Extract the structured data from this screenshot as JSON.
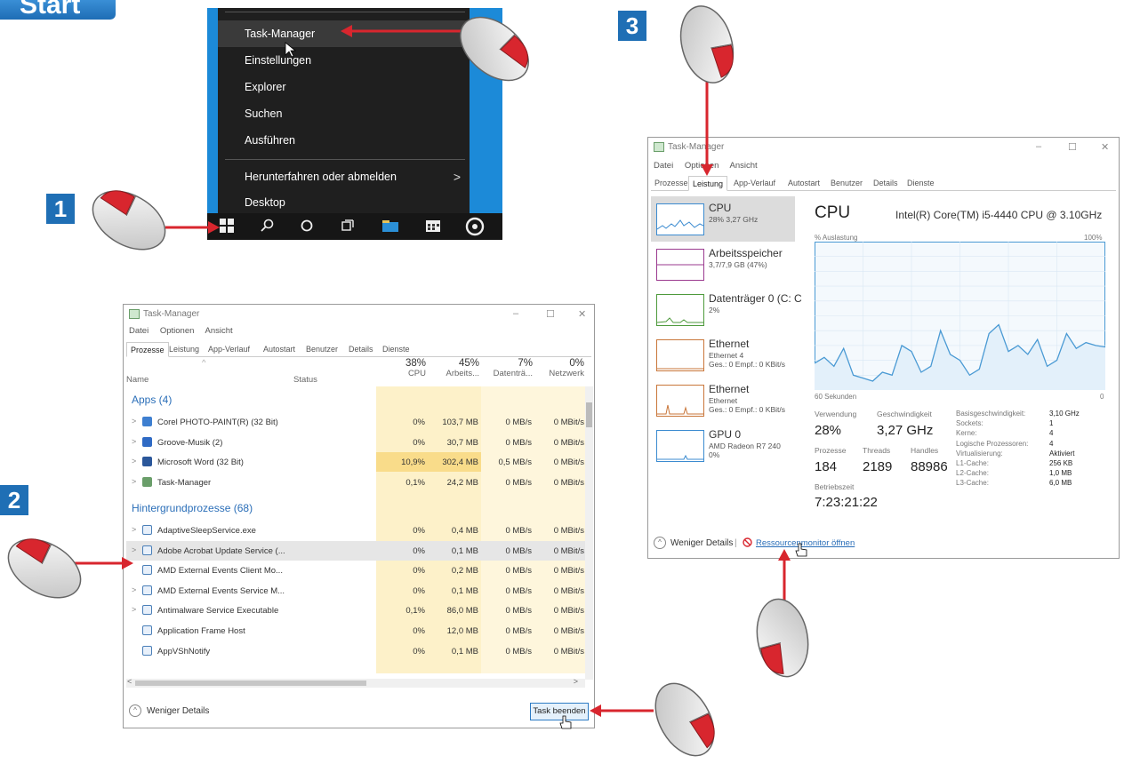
{
  "badges": {
    "start": "Start",
    "step1": "1",
    "step2": "2",
    "step3": "3"
  },
  "start_menu": {
    "items": [
      "Task-Manager",
      "Einstellungen",
      "Explorer",
      "Suchen",
      "Ausführen",
      "Herunterfahren oder abmelden",
      "Desktop"
    ],
    "chevron": ">"
  },
  "task_manager": {
    "title": "Task-Manager",
    "menu": [
      "Datei",
      "Optionen",
      "Ansicht"
    ],
    "tabs": [
      "Prozesse",
      "Leistung",
      "App-Verlauf",
      "Autostart",
      "Benutzer",
      "Details",
      "Dienste"
    ],
    "window_controls": [
      "–",
      "☐",
      "✕"
    ]
  },
  "processes": {
    "header": {
      "name": "Name",
      "status": "Status",
      "cpu_pct": "38%",
      "cpu_label": "CPU",
      "mem_pct": "45%",
      "mem_label": "Arbeits...",
      "disk_pct": "7%",
      "disk_label": "Datenträ...",
      "net_pct": "0%",
      "net_label": "Netzwerk"
    },
    "group_apps": "Apps (4)",
    "group_bg": "Hintergrundprozesse (68)",
    "apps": [
      {
        "name": "Corel PHOTO-PAINT(R) (32 Bit)",
        "cpu": "0%",
        "mem": "103,7 MB",
        "disk": "0 MB/s",
        "net": "0 MBit/s",
        "color": "#3e7fd0"
      },
      {
        "name": "Groove-Musik (2)",
        "cpu": "0%",
        "mem": "30,7 MB",
        "disk": "0 MB/s",
        "net": "0 MBit/s",
        "color": "#2f6ac4"
      },
      {
        "name": "Microsoft Word (32 Bit)",
        "cpu": "10,9%",
        "mem": "302,4 MB",
        "disk": "0,5 MB/s",
        "net": "0 MBit/s",
        "color": "#2b579a"
      },
      {
        "name": "Task-Manager",
        "cpu": "0,1%",
        "mem": "24,2 MB",
        "disk": "0 MB/s",
        "net": "0 MBit/s",
        "color": "#6a9e6a"
      }
    ],
    "background": [
      {
        "name": "AdaptiveSleepService.exe",
        "cpu": "0%",
        "mem": "0,4 MB",
        "disk": "0 MB/s",
        "net": "0 MBit/s"
      },
      {
        "name": "Adobe Acrobat Update Service (...",
        "cpu": "0%",
        "mem": "0,1 MB",
        "disk": "0 MB/s",
        "net": "0 MBit/s"
      },
      {
        "name": "AMD External Events Client Mo...",
        "cpu": "0%",
        "mem": "0,2 MB",
        "disk": "0 MB/s",
        "net": "0 MBit/s"
      },
      {
        "name": "AMD External Events Service M...",
        "cpu": "0%",
        "mem": "0,1 MB",
        "disk": "0 MB/s",
        "net": "0 MBit/s"
      },
      {
        "name": "Antimalware Service Executable",
        "cpu": "0,1%",
        "mem": "86,0 MB",
        "disk": "0 MB/s",
        "net": "0 MBit/s"
      },
      {
        "name": "Application Frame Host",
        "cpu": "0%",
        "mem": "12,0 MB",
        "disk": "0 MB/s",
        "net": "0 MBit/s"
      },
      {
        "name": "AppVShNotify",
        "cpu": "0%",
        "mem": "0,1 MB",
        "disk": "0 MB/s",
        "net": "0 MBit/s"
      }
    ],
    "footer_less": "Weniger Details",
    "end_task": "Task beenden",
    "scroll_left": "<",
    "scroll_right": ">"
  },
  "performance": {
    "sidebar": [
      {
        "name": "CPU",
        "sub1": "28% 3,27 GHz",
        "sub2": "",
        "color": "#3b8bd0"
      },
      {
        "name": "Arbeitsspeicher",
        "sub1": "3,7/7,9 GB (47%)",
        "sub2": "",
        "color": "#9b3a8f"
      },
      {
        "name": "Datenträger 0 (C: C",
        "sub1": "2%",
        "sub2": "",
        "color": "#4e9a3c"
      },
      {
        "name": "Ethernet",
        "sub1": "Ethernet 4",
        "sub2": "Ges.: 0 Empf.: 0 KBit/s",
        "color": "#c9763a"
      },
      {
        "name": "Ethernet",
        "sub1": "Ethernet",
        "sub2": "Ges.: 0 Empf.: 0 KBit/s",
        "color": "#c9763a"
      },
      {
        "name": "GPU 0",
        "sub1": "AMD Radeon R7 240",
        "sub2": "0%",
        "color": "#3b8bd0"
      }
    ],
    "title": "CPU",
    "cpu_name": "Intel(R) Core(TM) i5-4440 CPU @ 3.10GHz",
    "graph_top_left": "% Auslastung",
    "graph_top_right": "100%",
    "graph_bottom_left": "60 Sekunden",
    "graph_bottom_right": "0",
    "usage_series": [
      18,
      22,
      16,
      28,
      10,
      8,
      6,
      12,
      10,
      30,
      26,
      12,
      16,
      40,
      24,
      20,
      10,
      14,
      38,
      44,
      26,
      30,
      24,
      34,
      16,
      20,
      38,
      28,
      32,
      30,
      29
    ],
    "stats": {
      "usage_label": "Verwendung",
      "usage_value": "28%",
      "speed_label": "Geschwindigkeit",
      "speed_value": "3,27 GHz",
      "proc_label": "Prozesse",
      "proc_value": "184",
      "threads_label": "Threads",
      "threads_value": "2189",
      "handles_label": "Handles",
      "handles_value": "88986",
      "uptime_label": "Betriebszeit",
      "uptime_value": "7:23:21:22"
    },
    "specs": [
      {
        "label": "Basisgeschwindigkeit:",
        "value": "3,10 GHz"
      },
      {
        "label": "Sockets:",
        "value": "1"
      },
      {
        "label": "Kerne:",
        "value": "4"
      },
      {
        "label": "Logische Prozessoren:",
        "value": "4"
      },
      {
        "label": "Virtualisierung:",
        "value": "Aktiviert"
      },
      {
        "label": "L1-Cache:",
        "value": "256 KB"
      },
      {
        "label": "L2-Cache:",
        "value": "1,0 MB"
      },
      {
        "label": "L3-Cache:",
        "value": "6,0 MB"
      }
    ],
    "footer_less": "Weniger Details",
    "footer_sep": "|",
    "resource_link": "Ressourcenmonitor öffnen"
  },
  "colors": {
    "accent_red": "#d8262e",
    "badge_blue": "#1f6fb5",
    "win_blue": "#1c8ad8",
    "cpu_line": "#4a9ad4",
    "cell_yellow": "#fdf1c9",
    "cell_yellow_hot": "#f9dc8a"
  }
}
